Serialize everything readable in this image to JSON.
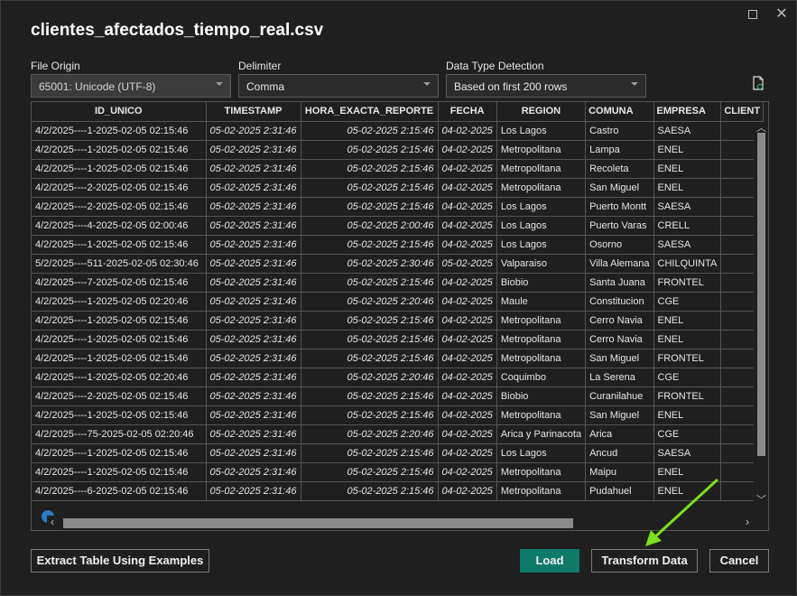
{
  "window": {
    "title": "clientes_afectados_tiempo_real.csv"
  },
  "options": {
    "file_origin": {
      "label": "File Origin",
      "value": "65001: Unicode (UTF-8)"
    },
    "delimiter": {
      "label": "Delimiter",
      "value": "Comma"
    },
    "detection": {
      "label": "Data Type Detection",
      "value": "Based on first 200 rows"
    }
  },
  "table": {
    "columns": [
      "ID_UNICO",
      "TIMESTAMP",
      "HORA_EXACTA_REPORTE",
      "FECHA",
      "REGION",
      "COMUNA",
      "EMPRESA",
      "CLIENT"
    ],
    "rows": [
      [
        "4/2/2025----1-2025-02-05 02:15:46",
        "05-02-2025 2:31:46",
        "05-02-2025 2:15:46",
        "04-02-2025",
        "Los Lagos",
        "Castro",
        "SAESA",
        ""
      ],
      [
        "4/2/2025----1-2025-02-05 02:15:46",
        "05-02-2025 2:31:46",
        "05-02-2025 2:15:46",
        "04-02-2025",
        "Metropolitana",
        "Lampa",
        "ENEL",
        ""
      ],
      [
        "4/2/2025----1-2025-02-05 02:15:46",
        "05-02-2025 2:31:46",
        "05-02-2025 2:15:46",
        "04-02-2025",
        "Metropolitana",
        "Recoleta",
        "ENEL",
        ""
      ],
      [
        "4/2/2025----2-2025-02-05 02:15:46",
        "05-02-2025 2:31:46",
        "05-02-2025 2:15:46",
        "04-02-2025",
        "Metropolitana",
        "San Miguel",
        "ENEL",
        ""
      ],
      [
        "4/2/2025----2-2025-02-05 02:15:46",
        "05-02-2025 2:31:46",
        "05-02-2025 2:15:46",
        "04-02-2025",
        "Los Lagos",
        "Puerto Montt",
        "SAESA",
        ""
      ],
      [
        "4/2/2025----4-2025-02-05 02:00:46",
        "05-02-2025 2:31:46",
        "05-02-2025 2:00:46",
        "04-02-2025",
        "Los Lagos",
        "Puerto Varas",
        "CRELL",
        ""
      ],
      [
        "4/2/2025----1-2025-02-05 02:15:46",
        "05-02-2025 2:31:46",
        "05-02-2025 2:15:46",
        "04-02-2025",
        "Los Lagos",
        "Osorno",
        "SAESA",
        ""
      ],
      [
        "5/2/2025----511-2025-02-05 02:30:46",
        "05-02-2025 2:31:46",
        "05-02-2025 2:30:46",
        "05-02-2025",
        "Valparaiso",
        "Villa Alemana",
        "CHILQUINTA",
        ""
      ],
      [
        "4/2/2025----7-2025-02-05 02:15:46",
        "05-02-2025 2:31:46",
        "05-02-2025 2:15:46",
        "04-02-2025",
        "Biobio",
        "Santa Juana",
        "FRONTEL",
        ""
      ],
      [
        "4/2/2025----1-2025-02-05 02:20:46",
        "05-02-2025 2:31:46",
        "05-02-2025 2:20:46",
        "04-02-2025",
        "Maule",
        "Constitucion",
        "CGE",
        ""
      ],
      [
        "4/2/2025----1-2025-02-05 02:15:46",
        "05-02-2025 2:31:46",
        "05-02-2025 2:15:46",
        "04-02-2025",
        "Metropolitana",
        "Cerro Navia",
        "ENEL",
        ""
      ],
      [
        "4/2/2025----1-2025-02-05 02:15:46",
        "05-02-2025 2:31:46",
        "05-02-2025 2:15:46",
        "04-02-2025",
        "Metropolitana",
        "Cerro Navia",
        "ENEL",
        ""
      ],
      [
        "4/2/2025----1-2025-02-05 02:15:46",
        "05-02-2025 2:31:46",
        "05-02-2025 2:15:46",
        "04-02-2025",
        "Metropolitana",
        "San Miguel",
        "FRONTEL",
        ""
      ],
      [
        "4/2/2025----1-2025-02-05 02:20:46",
        "05-02-2025 2:31:46",
        "05-02-2025 2:20:46",
        "04-02-2025",
        "Coquimbo",
        "La Serena",
        "CGE",
        ""
      ],
      [
        "4/2/2025----2-2025-02-05 02:15:46",
        "05-02-2025 2:31:46",
        "05-02-2025 2:15:46",
        "04-02-2025",
        "Biobio",
        "Curanilahue",
        "FRONTEL",
        ""
      ],
      [
        "4/2/2025----1-2025-02-05 02:15:46",
        "05-02-2025 2:31:46",
        "05-02-2025 2:15:46",
        "04-02-2025",
        "Metropolitana",
        "San Miguel",
        "ENEL",
        ""
      ],
      [
        "4/2/2025----75-2025-02-05 02:20:46",
        "05-02-2025 2:31:46",
        "05-02-2025 2:20:46",
        "04-02-2025",
        "Arica y Parinacota",
        "Arica",
        "CGE",
        ""
      ],
      [
        "4/2/2025----1-2025-02-05 02:15:46",
        "05-02-2025 2:31:46",
        "05-02-2025 2:15:46",
        "04-02-2025",
        "Los Lagos",
        "Ancud",
        "SAESA",
        ""
      ],
      [
        "4/2/2025----1-2025-02-05 02:15:46",
        "05-02-2025 2:31:46",
        "05-02-2025 2:15:46",
        "04-02-2025",
        "Metropolitana",
        "Maipu",
        "ENEL",
        ""
      ],
      [
        "4/2/2025----6-2025-02-05 02:15:46",
        "05-02-2025 2:31:46",
        "05-02-2025 2:15:46",
        "04-02-2025",
        "Metropolitana",
        "Pudahuel",
        "ENEL",
        ""
      ]
    ]
  },
  "buttons": {
    "extract": "Extract Table Using Examples",
    "load": "Load",
    "transform": "Transform Data",
    "cancel": "Cancel"
  },
  "colors": {
    "accent": "#0e7a6a",
    "arrow": "#7ce01a"
  }
}
